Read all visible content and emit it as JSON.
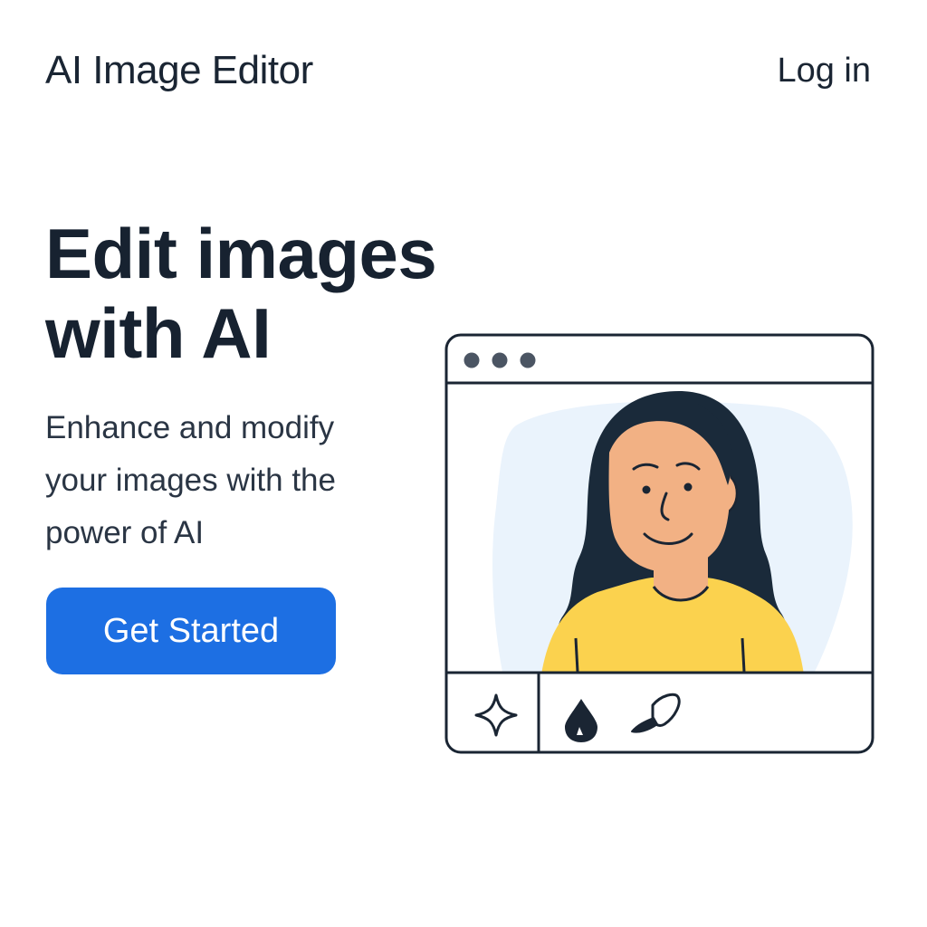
{
  "header": {
    "brand": "AI Image Editor",
    "login_label": "Log in"
  },
  "hero": {
    "title_lines": [
      "Edit images",
      "with AI"
    ],
    "subtitle_lines": [
      "Enhance and modify",
      "your images with the",
      "power of AI"
    ],
    "cta_label": "Get Started"
  },
  "illustration": {
    "window_dots": 3,
    "toolbar_tools": [
      "sparkle-icon",
      "drop-icon",
      "brush-icon"
    ]
  },
  "colors": {
    "background": "#ffffff",
    "text": "#1a2533",
    "accent": "#1d6fe3",
    "window_outline": "#1a2533",
    "hair": "#1a2533",
    "skin": "#f2b184",
    "shirt": "#fbd24e",
    "blob": "#eaf3fc"
  }
}
